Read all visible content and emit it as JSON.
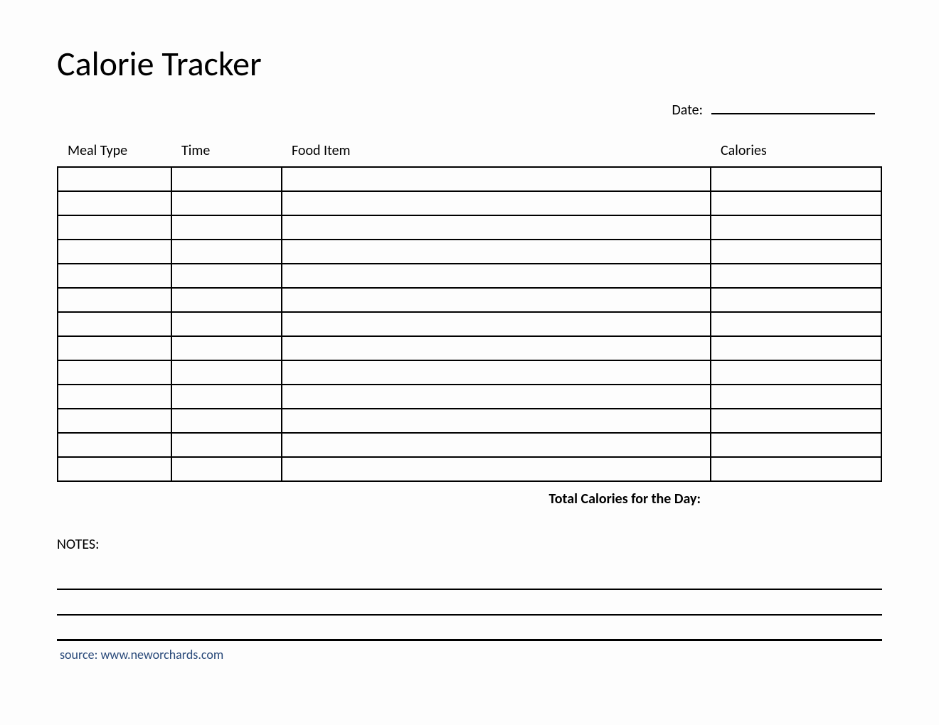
{
  "title": "Calorie Tracker",
  "date_label": "Date:",
  "date_value": "",
  "columns": {
    "meal_type": "Meal Type",
    "time": "Time",
    "food_item": "Food Item",
    "calories": "Calories"
  },
  "rows": [
    {
      "meal_type": "",
      "time": "",
      "food_item": "",
      "calories": ""
    },
    {
      "meal_type": "",
      "time": "",
      "food_item": "",
      "calories": ""
    },
    {
      "meal_type": "",
      "time": "",
      "food_item": "",
      "calories": ""
    },
    {
      "meal_type": "",
      "time": "",
      "food_item": "",
      "calories": ""
    },
    {
      "meal_type": "",
      "time": "",
      "food_item": "",
      "calories": ""
    },
    {
      "meal_type": "",
      "time": "",
      "food_item": "",
      "calories": ""
    },
    {
      "meal_type": "",
      "time": "",
      "food_item": "",
      "calories": ""
    },
    {
      "meal_type": "",
      "time": "",
      "food_item": "",
      "calories": ""
    },
    {
      "meal_type": "",
      "time": "",
      "food_item": "",
      "calories": ""
    },
    {
      "meal_type": "",
      "time": "",
      "food_item": "",
      "calories": ""
    },
    {
      "meal_type": "",
      "time": "",
      "food_item": "",
      "calories": ""
    },
    {
      "meal_type": "",
      "time": "",
      "food_item": "",
      "calories": ""
    },
    {
      "meal_type": "",
      "time": "",
      "food_item": "",
      "calories": ""
    }
  ],
  "total_label": "Total Calories for the Day:",
  "total_value": "",
  "notes_label": "NOTES:",
  "note_lines": [
    "",
    "",
    ""
  ],
  "source_label": "source: www.neworchards.com"
}
